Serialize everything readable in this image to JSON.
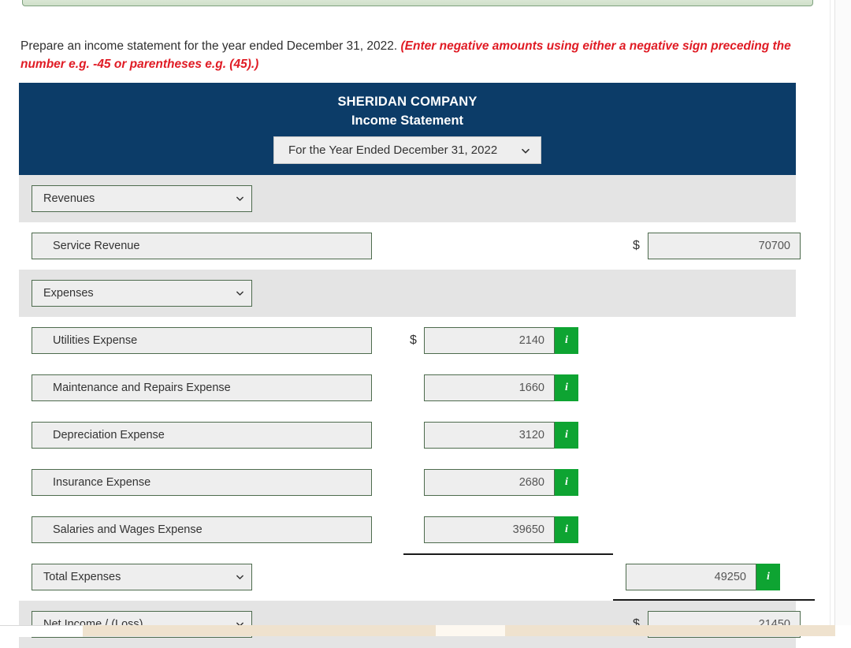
{
  "instructions": {
    "main": "Prepare an income statement for the year ended December 31, 2022. ",
    "warning": "(Enter negative amounts using either a negative sign preceding the number e.g. -45 or parentheses e.g. (45).)"
  },
  "statement": {
    "company": "SHERIDAN COMPANY",
    "title": "Income Statement",
    "period_select": {
      "value": "For the Year Ended December 31, 2022",
      "icon": "chevron-down-icon"
    },
    "sections": [
      {
        "id": "revenues",
        "header_select": "Revenues",
        "lines": [
          {
            "label": "Service Revenue",
            "dollar_sign": "$",
            "amount": "70700",
            "column": "far",
            "has_info": false
          }
        ]
      },
      {
        "id": "expenses",
        "header_select": "Expenses",
        "lines": [
          {
            "label": "Utilities Expense",
            "dollar_sign": "$",
            "amount": "2140",
            "column": "mid",
            "has_info": true,
            "info_icon": "info-icon"
          },
          {
            "label": "Maintenance and Repairs Expense",
            "dollar_sign": "",
            "amount": "1660",
            "column": "mid",
            "has_info": true,
            "info_icon": "info-icon"
          },
          {
            "label": "Depreciation Expense",
            "dollar_sign": "",
            "amount": "3120",
            "column": "mid",
            "has_info": true,
            "info_icon": "info-icon"
          },
          {
            "label": "Insurance Expense",
            "dollar_sign": "",
            "amount": "2680",
            "column": "mid",
            "has_info": true,
            "info_icon": "info-icon"
          },
          {
            "label": "Salaries and Wages Expense",
            "dollar_sign": "",
            "amount": "39650",
            "column": "mid",
            "has_info": true,
            "info_icon": "info-icon"
          }
        ]
      }
    ],
    "total_expenses": {
      "label_select": "Total Expenses",
      "amount": "49250",
      "has_info": true,
      "info_icon": "info-icon"
    },
    "net_income": {
      "label_select": "Net Income / (Loss)",
      "dollar_sign": "$",
      "amount": "21450",
      "has_info": false
    }
  },
  "colors": {
    "header_blue": "#0c3c68",
    "info_green": "#0ea432",
    "warning_red": "#e01b24",
    "shaded_row": "#e4e4e4",
    "field_border": "#4d6b4d",
    "field_fill": "#eeeeee"
  }
}
